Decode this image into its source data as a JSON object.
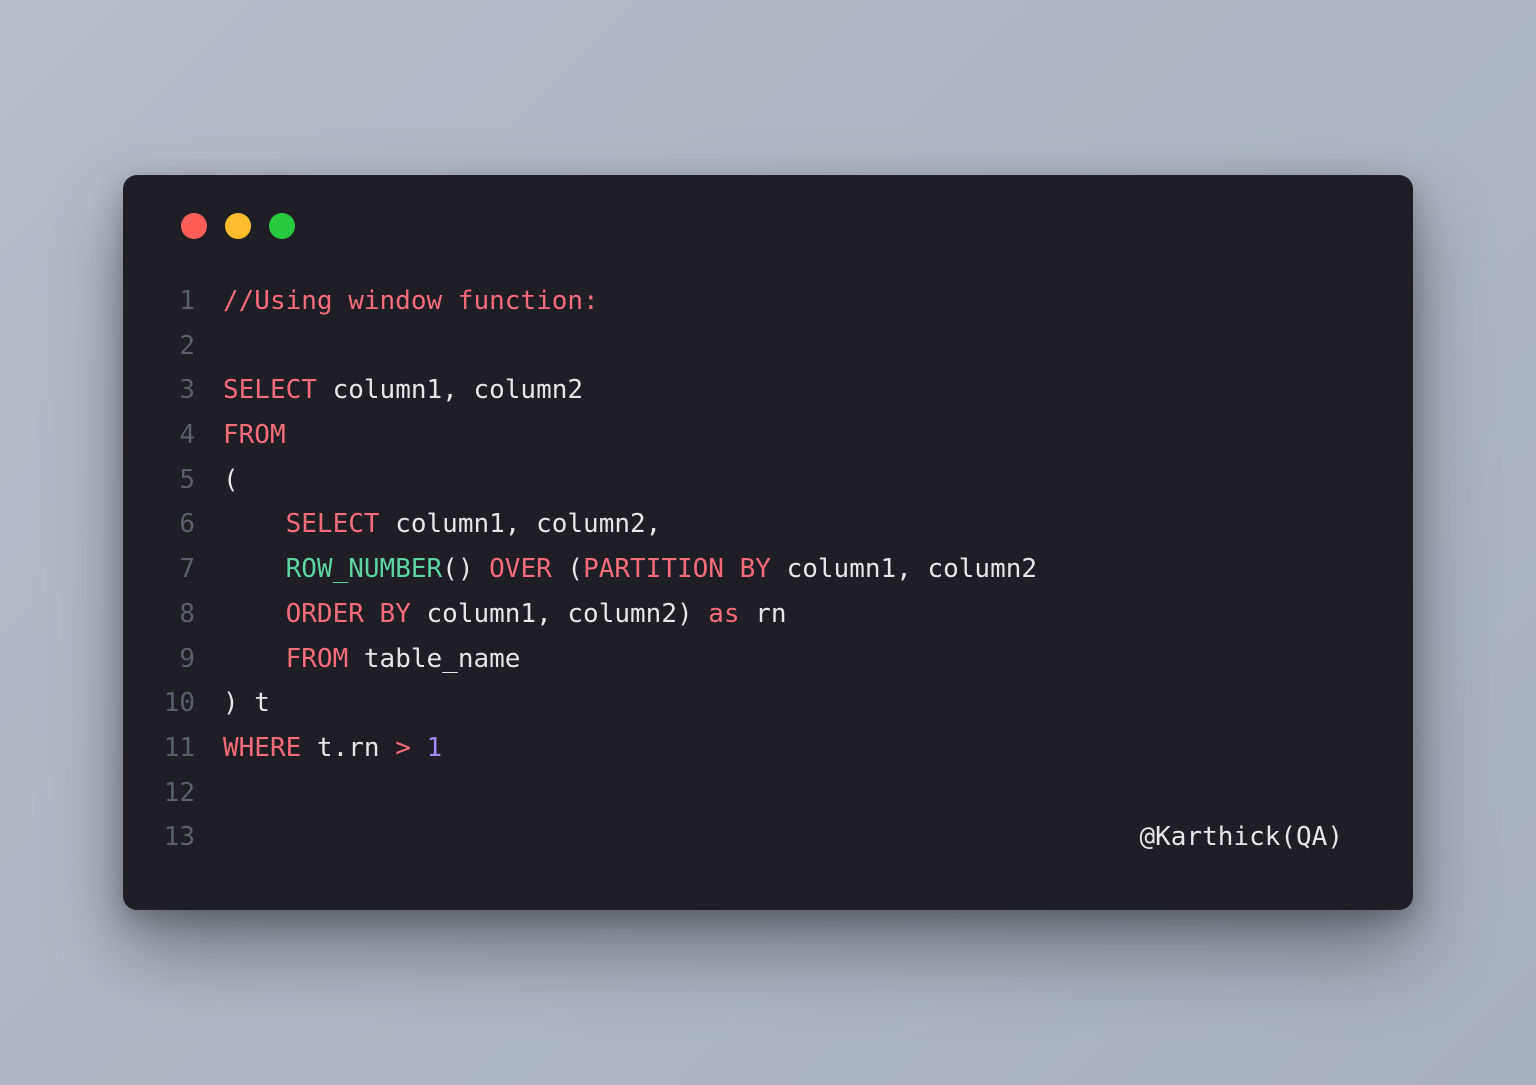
{
  "traffic": {
    "red": "#ff5f56",
    "yellow": "#ffbd2e",
    "green": "#27c93f"
  },
  "lines": {
    "l1": {
      "n": "1",
      "t1": "//Using window function:"
    },
    "l2": {
      "n": "2"
    },
    "l3": {
      "n": "3",
      "kw": "SELECT",
      "rest": " column1, column2"
    },
    "l4": {
      "n": "4",
      "kw": "FROM"
    },
    "l5": {
      "n": "5",
      "p": "("
    },
    "l6": {
      "n": "6",
      "indent": "    ",
      "kw": "SELECT",
      "rest": " column1, column2,"
    },
    "l7": {
      "n": "7",
      "indent": "    ",
      "func": "ROW_NUMBER",
      "paren": "()",
      "sp": " ",
      "kw1": "OVER",
      "sp2": " ",
      "open": "(",
      "kw2": "PARTITION BY",
      "rest": " column1, column2"
    },
    "l8": {
      "n": "8",
      "indent": "    ",
      "kw": "ORDER BY",
      "mid": " column1, column2",
      "close": ")",
      "sp": " ",
      "kw2": "as",
      "rest": " rn"
    },
    "l9": {
      "n": "9",
      "indent": "    ",
      "kw": "FROM",
      "rest": " table_name"
    },
    "l10": {
      "n": "10",
      "p": ")",
      "rest": " t"
    },
    "l11": {
      "n": "11",
      "kw": "WHERE",
      "mid": " t.rn ",
      "op": ">",
      "sp": " ",
      "num": "1"
    },
    "l12": {
      "n": "12"
    },
    "l13": {
      "n": "13",
      "credit": "@Karthick(QA)"
    }
  }
}
